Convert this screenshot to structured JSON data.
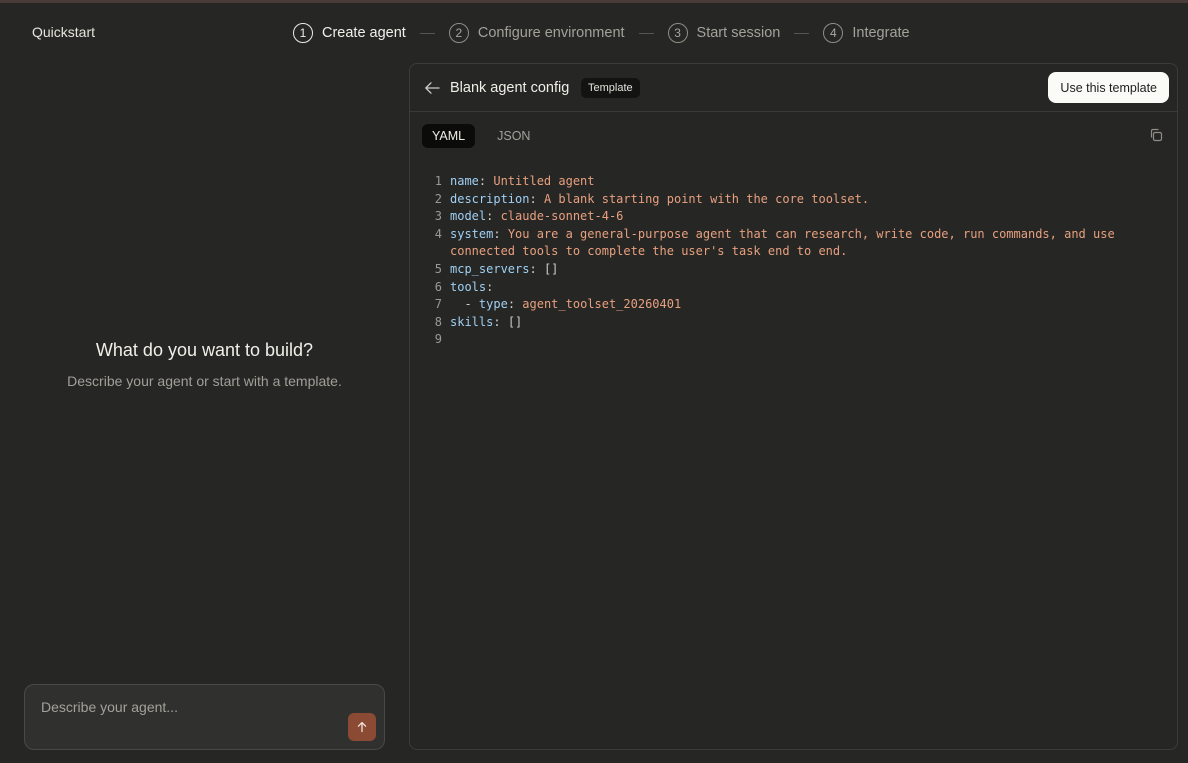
{
  "app": {
    "title": "Quickstart"
  },
  "stepper": {
    "steps": [
      {
        "number": "1",
        "label": "Create agent"
      },
      {
        "number": "2",
        "label": "Configure environment"
      },
      {
        "number": "3",
        "label": "Start session"
      },
      {
        "number": "4",
        "label": "Integrate"
      }
    ],
    "active_step": 1
  },
  "empty_state": {
    "title": "What do you want to build?",
    "subtitle": "Describe your agent or start with a template."
  },
  "prompt": {
    "placeholder": "Describe your agent..."
  },
  "panel": {
    "title": "Blank agent config",
    "badge": "Template",
    "use_button": "Use this template",
    "tabs": [
      "YAML",
      "JSON"
    ],
    "active_tab": "YAML"
  },
  "code": {
    "line_numbers": [
      "1",
      "2",
      "3",
      "4",
      "",
      "5",
      "6",
      "7",
      "8",
      "9"
    ],
    "lines": [
      {
        "indent": "",
        "key": "name",
        "sep": ": ",
        "value": "Untitled agent"
      },
      {
        "indent": "",
        "key": "description",
        "sep": ": ",
        "value": "A blank starting point with the core toolset."
      },
      {
        "indent": "",
        "key": "model",
        "sep": ": ",
        "value": "claude-sonnet-4-6"
      },
      {
        "indent": "",
        "key": "system",
        "sep": ": ",
        "value": "You are a general-purpose agent that can research, write code, run commands, and use"
      },
      {
        "indent": "",
        "key": "",
        "sep": "",
        "value": "connected tools to complete the user's task end to end."
      },
      {
        "indent": "",
        "key": "mcp_servers",
        "sep": ": ",
        "value": "[]"
      },
      {
        "indent": "",
        "key": "tools",
        "sep": ":",
        "value": ""
      },
      {
        "indent": "  - ",
        "key": "type",
        "sep": ": ",
        "value": "agent_toolset_20260401"
      },
      {
        "indent": "",
        "key": "skills",
        "sep": ": ",
        "value": "[]"
      },
      {
        "indent": "",
        "key": "",
        "sep": "",
        "value": ""
      }
    ]
  },
  "colors": {
    "background": "#262624",
    "yaml_key": "#9fd0f4",
    "yaml_string": "#e8a07f",
    "send_button": "#8a4a33",
    "primary_button": "#fafaf7"
  },
  "icons": {
    "back": "arrow-left-icon",
    "copy": "copy-icon",
    "send": "arrow-up-icon"
  }
}
